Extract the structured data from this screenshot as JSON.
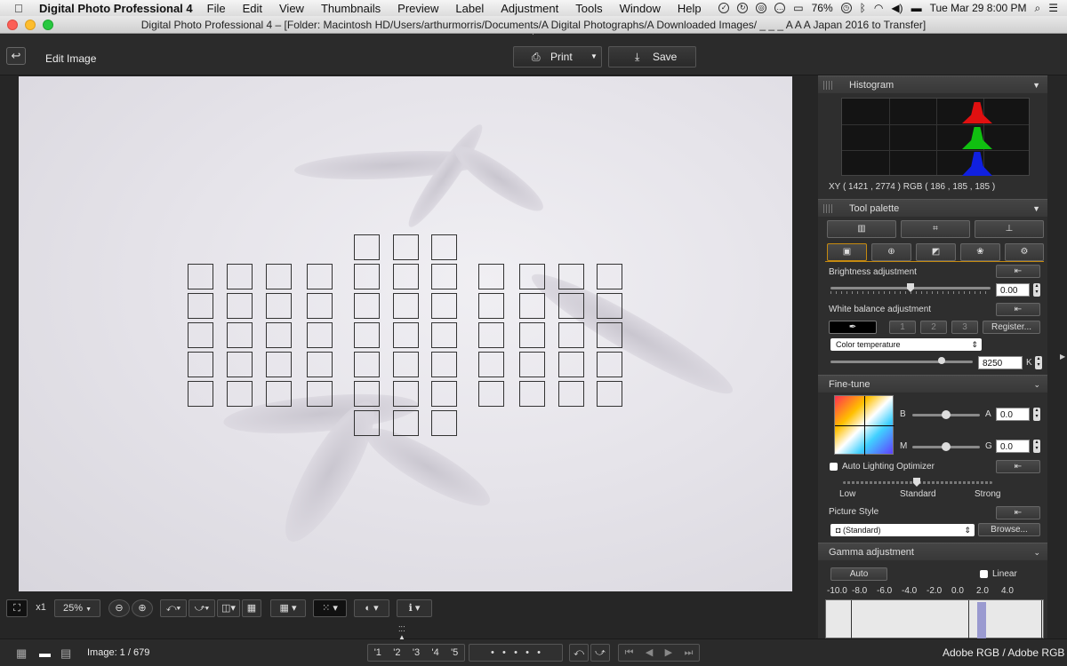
{
  "menubar": {
    "app_name": "Digital Photo Professional 4",
    "items": [
      "File",
      "Edit",
      "View",
      "Thumbnails",
      "Preview",
      "Label",
      "Adjustment",
      "Tools",
      "Window",
      "Help"
    ],
    "battery": "76%",
    "datetime": "Tue Mar 29  8:00 PM"
  },
  "window": {
    "title": "Digital Photo Professional 4 – [Folder: Macintosh HD/Users/arthurmorris/Documents/A Digital Photographs/A Downloaded Images/ _ _ _ A A A Japan 2016 to Transfer]"
  },
  "toolbar": {
    "title": "Edit Image",
    "print_label": "Print",
    "save_label": "Save"
  },
  "histogram": {
    "header": "Histogram",
    "xy_readout": "XY (    1421 ,    2774  ) RGB ( 186 ,  185 ,  185  )",
    "channel_colors": [
      "#e01010",
      "#10c010",
      "#1020e0"
    ]
  },
  "tool_palette": {
    "header": "Tool palette",
    "brightness_label": "Brightness adjustment",
    "brightness_value": "0.00",
    "brightness_level": 0.5,
    "wb_label": "White balance adjustment",
    "wb_slots": [
      "1",
      "2",
      "3"
    ],
    "register_label": "Register...",
    "wb_mode": "Color temperature",
    "temp_value": "8250",
    "temp_unit": "K",
    "temp_level": 0.78
  },
  "fine_tune": {
    "header": "Fine-tune",
    "b_label": "B",
    "a_label": "A",
    "ba_value": "0.0",
    "m_label": "M",
    "g_label": "G",
    "mg_value": "0.0",
    "alo_label": "Auto Lighting Optimizer",
    "alo_low": "Low",
    "alo_standard": "Standard",
    "alo_strong": "Strong",
    "picture_style_label": "Picture Style",
    "picture_style_value": "(Standard)",
    "browse_label": "Browse..."
  },
  "gamma": {
    "header": "Gamma adjustment",
    "auto_label": "Auto",
    "linear_label": "Linear",
    "scale": [
      "-10.0",
      "-8.0",
      "-6.0",
      "-4.0",
      "-2.0",
      "0.0",
      "2.0",
      "4.0"
    ]
  },
  "view_controls": {
    "zoom_x1": "x1",
    "zoom_value": "25%"
  },
  "status": {
    "image_count": "Image: 1 / 679",
    "color_space": "Adobe RGB / Adobe RGB",
    "ratings": [
      "'1",
      "'2",
      "'3",
      "'4",
      "'5"
    ]
  }
}
